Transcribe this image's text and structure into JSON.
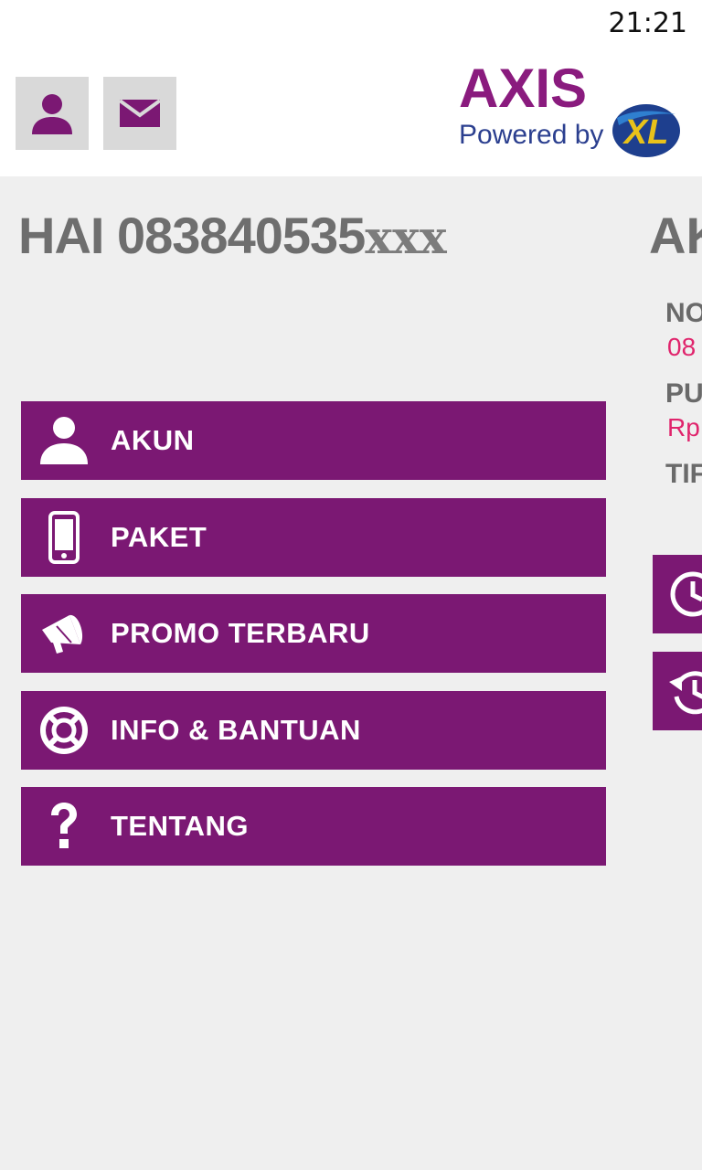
{
  "status_bar": {
    "time": "21:21"
  },
  "header": {
    "profile_icon": "person-icon",
    "mail_icon": "mail-icon",
    "logo": {
      "brand": "AXIS",
      "tagline": "Powered by",
      "partner": "XL"
    }
  },
  "greeting": {
    "prefix": "HAI 083840535",
    "masked": "xxx"
  },
  "menu": [
    {
      "label": "AKUN",
      "icon": "person-icon"
    },
    {
      "label": "PAKET",
      "icon": "phone-icon"
    },
    {
      "label": "PROMO TERBARU",
      "icon": "megaphone-icon"
    },
    {
      "label": "INFO & BANTUAN",
      "icon": "lifebuoy-icon"
    },
    {
      "label": "TENTANG",
      "icon": "question-icon"
    }
  ],
  "right_panel": {
    "title": "AK",
    "items": [
      {
        "label": "NO",
        "value": "08"
      },
      {
        "label": "PU",
        "value": "Rp"
      },
      {
        "label": "TIF"
      }
    ],
    "buttons": [
      {
        "icon": "clock-icon"
      },
      {
        "icon": "history-icon"
      }
    ]
  },
  "colors": {
    "brand_purple": "#7b1873",
    "accent_pink": "#e0246c",
    "text_gray": "#6e6e6e",
    "background": "#efefef"
  }
}
